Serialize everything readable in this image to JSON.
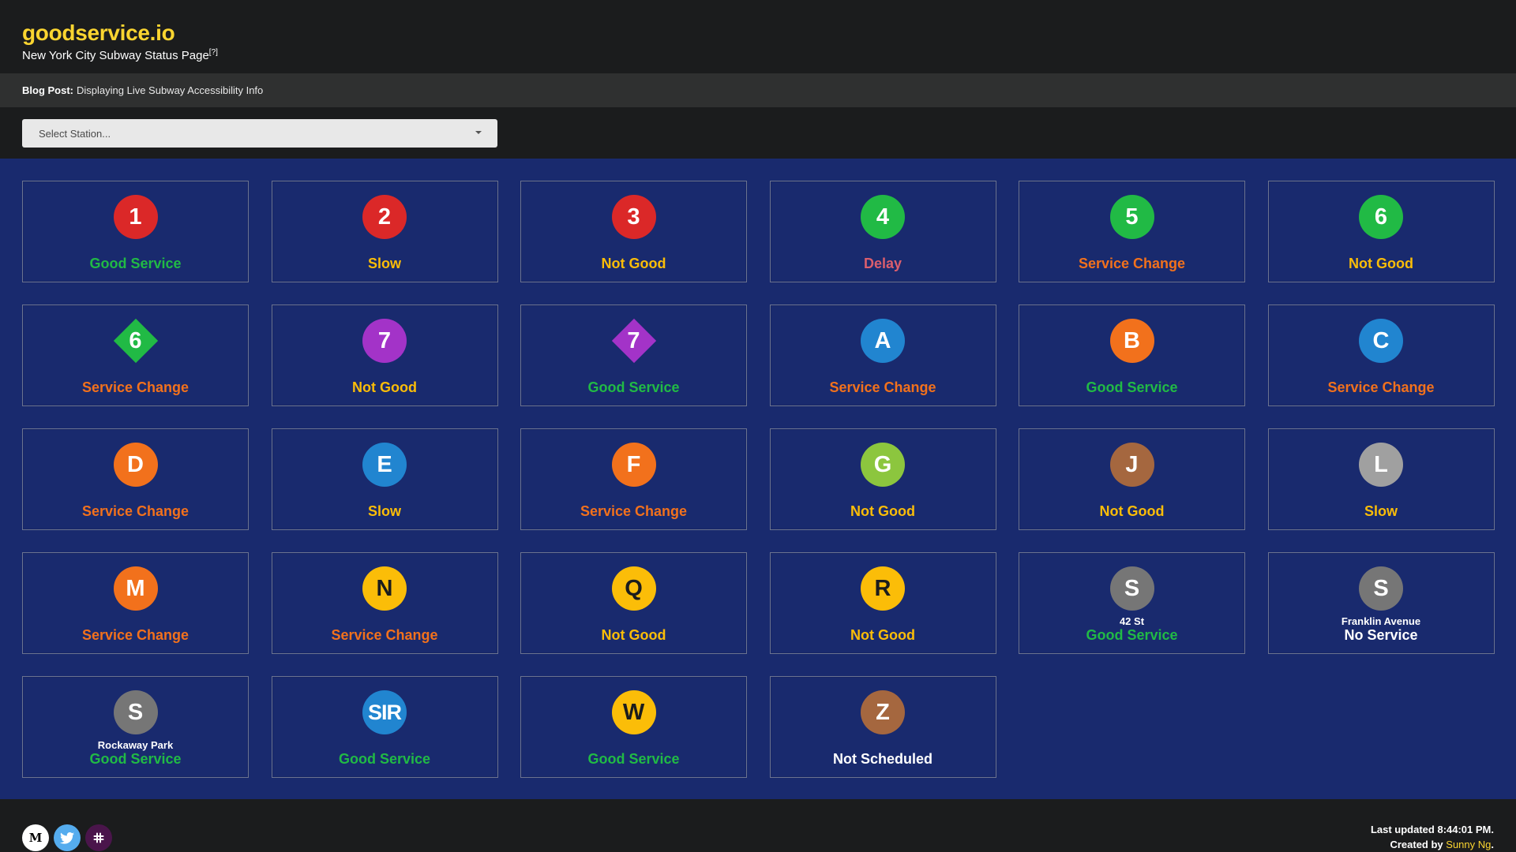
{
  "site": {
    "title": "goodservice.io",
    "subtitle": "New York City Subway Status Page",
    "help_marker": "[?]"
  },
  "blog": {
    "prefix": "Blog Post:",
    "link_text": "Displaying Live Subway Accessibility Info"
  },
  "station_select": {
    "placeholder": "Select Station..."
  },
  "status_colors": {
    "Good Service": "#21ba45",
    "Slow": "#fbbd08",
    "Not Good": "#fbbd08",
    "Delay": "#db5e6d",
    "Service Change": "#f2711c",
    "No Service": "#ffffff",
    "Not Scheduled": "#ffffff"
  },
  "routes": [
    {
      "id": "1",
      "label": "1",
      "color": "#db2828",
      "shape": "circle",
      "status": "Good Service"
    },
    {
      "id": "2",
      "label": "2",
      "color": "#db2828",
      "shape": "circle",
      "status": "Slow"
    },
    {
      "id": "3",
      "label": "3",
      "color": "#db2828",
      "shape": "circle",
      "status": "Not Good"
    },
    {
      "id": "4",
      "label": "4",
      "color": "#21ba45",
      "shape": "circle",
      "status": "Delay"
    },
    {
      "id": "5",
      "label": "5",
      "color": "#21ba45",
      "shape": "circle",
      "status": "Service Change"
    },
    {
      "id": "6",
      "label": "6",
      "color": "#21ba45",
      "shape": "circle",
      "status": "Not Good"
    },
    {
      "id": "6X",
      "label": "6",
      "color": "#21ba45",
      "shape": "diamond",
      "status": "Service Change"
    },
    {
      "id": "7",
      "label": "7",
      "color": "#a333c8",
      "shape": "circle",
      "status": "Not Good"
    },
    {
      "id": "7X",
      "label": "7",
      "color": "#a333c8",
      "shape": "diamond",
      "status": "Good Service"
    },
    {
      "id": "A",
      "label": "A",
      "color": "#2185d0",
      "shape": "circle",
      "status": "Service Change"
    },
    {
      "id": "B",
      "label": "B",
      "color": "#f2711c",
      "shape": "circle",
      "status": "Good Service"
    },
    {
      "id": "C",
      "label": "C",
      "color": "#2185d0",
      "shape": "circle",
      "status": "Service Change"
    },
    {
      "id": "D",
      "label": "D",
      "color": "#f2711c",
      "shape": "circle",
      "status": "Service Change"
    },
    {
      "id": "E",
      "label": "E",
      "color": "#2185d0",
      "shape": "circle",
      "status": "Slow"
    },
    {
      "id": "F",
      "label": "F",
      "color": "#f2711c",
      "shape": "circle",
      "status": "Service Change"
    },
    {
      "id": "G",
      "label": "G",
      "color": "#8cc63e",
      "shape": "circle",
      "status": "Not Good"
    },
    {
      "id": "J",
      "label": "J",
      "color": "#a5673f",
      "shape": "circle",
      "status": "Not Good"
    },
    {
      "id": "L",
      "label": "L",
      "color": "#a0a0a0",
      "shape": "circle",
      "status": "Slow"
    },
    {
      "id": "M",
      "label": "M",
      "color": "#f2711c",
      "shape": "circle",
      "status": "Service Change"
    },
    {
      "id": "N",
      "label": "N",
      "color": "#fbbd08",
      "shape": "circle",
      "dark_text": true,
      "status": "Service Change"
    },
    {
      "id": "Q",
      "label": "Q",
      "color": "#fbbd08",
      "shape": "circle",
      "dark_text": true,
      "status": "Not Good"
    },
    {
      "id": "R",
      "label": "R",
      "color": "#fbbd08",
      "shape": "circle",
      "dark_text": true,
      "status": "Not Good"
    },
    {
      "id": "GS",
      "label": "S",
      "color": "#767676",
      "shape": "circle",
      "station": "42 St",
      "status": "Good Service"
    },
    {
      "id": "FS",
      "label": "S",
      "color": "#767676",
      "shape": "circle",
      "station": "Franklin Avenue",
      "status": "No Service"
    },
    {
      "id": "H",
      "label": "S",
      "color": "#767676",
      "shape": "circle",
      "station": "Rockaway Park",
      "status": "Good Service"
    },
    {
      "id": "SI",
      "label": "SIR",
      "color": "#2185d0",
      "shape": "circle",
      "status": "Good Service"
    },
    {
      "id": "W",
      "label": "W",
      "color": "#fbbd08",
      "shape": "circle",
      "dark_text": true,
      "status": "Good Service"
    },
    {
      "id": "Z",
      "label": "Z",
      "color": "#a5673f",
      "shape": "circle",
      "status": "Not Scheduled"
    }
  ],
  "footer": {
    "last_updated": "Last updated 8:44:01 PM.",
    "created_prefix": "Created by ",
    "author": "Sunny Ng",
    "created_suffix": ".",
    "social": [
      "medium-icon",
      "twitter-icon",
      "slack-icon"
    ],
    "medium_glyph": "M"
  }
}
